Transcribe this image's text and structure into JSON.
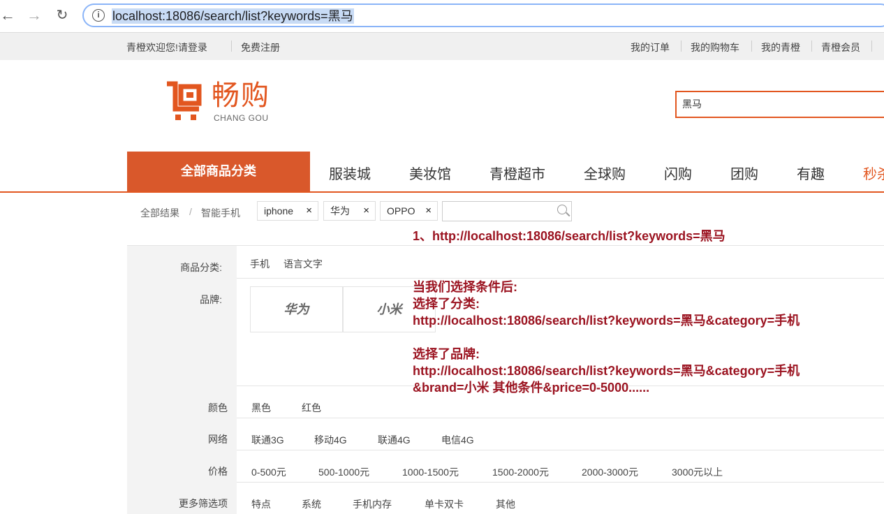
{
  "browser": {
    "url": "localhost:18086/search/list?keywords=黑马"
  },
  "topbar": {
    "welcome": "青橙欢迎您!请登录",
    "register": "免费注册",
    "links": [
      "我的订单",
      "我的购物车",
      "我的青橙",
      "青橙会员"
    ]
  },
  "logo": {
    "cn": "畅购",
    "en": "CHANG GOU"
  },
  "search": {
    "value": "黑马"
  },
  "mainnav": {
    "all_categories": "全部商品分类",
    "items": [
      "服装城",
      "美妆馆",
      "青橙超市",
      "全球购",
      "闪购",
      "团购",
      "有趣",
      "秒杀"
    ]
  },
  "breadcrumb": {
    "root": "全部结果",
    "divider": "/",
    "category": "智能手机",
    "tags": [
      "iphone",
      "华为",
      "OPPO"
    ],
    "remove_glyph": "×"
  },
  "filters": {
    "category": {
      "label": "商品分类:",
      "options": [
        "手机",
        "语言文字"
      ]
    },
    "brand": {
      "label": "品牌:",
      "options": [
        "华为",
        "小米"
      ]
    },
    "color": {
      "label": "颜色",
      "options": [
        "黑色",
        "红色"
      ]
    },
    "network": {
      "label": "网络",
      "options": [
        "联通3G",
        "移动4G",
        "联通4G",
        "电信4G"
      ]
    },
    "price": {
      "label": "价格",
      "options": [
        "0-500元",
        "500-1000元",
        "1000-1500元",
        "1500-2000元",
        "2000-3000元",
        "3000元以上"
      ]
    },
    "more": {
      "label": "更多筛选项",
      "options": [
        "特点",
        "系统",
        "手机内存",
        "单卡双卡",
        "其他"
      ]
    }
  },
  "annotation": {
    "line1": "1、http://localhost:18086/search/list?keywords=黑马",
    "line2": "当我们选择条件后:",
    "line3": "选择了分类:",
    "line4": "http://localhost:18086/search/list?keywords=黑马&category=手机",
    "line5": "选择了品牌:",
    "line6": "http://localhost:18086/search/list?keywords=黑马&category=手机",
    "line7": "&brand=小米   其他条件&price=0-5000......"
  },
  "colors": {
    "brand_orange": "#e2561f",
    "nav_orange": "#d9582b",
    "annotation_red": "#9b1320"
  }
}
